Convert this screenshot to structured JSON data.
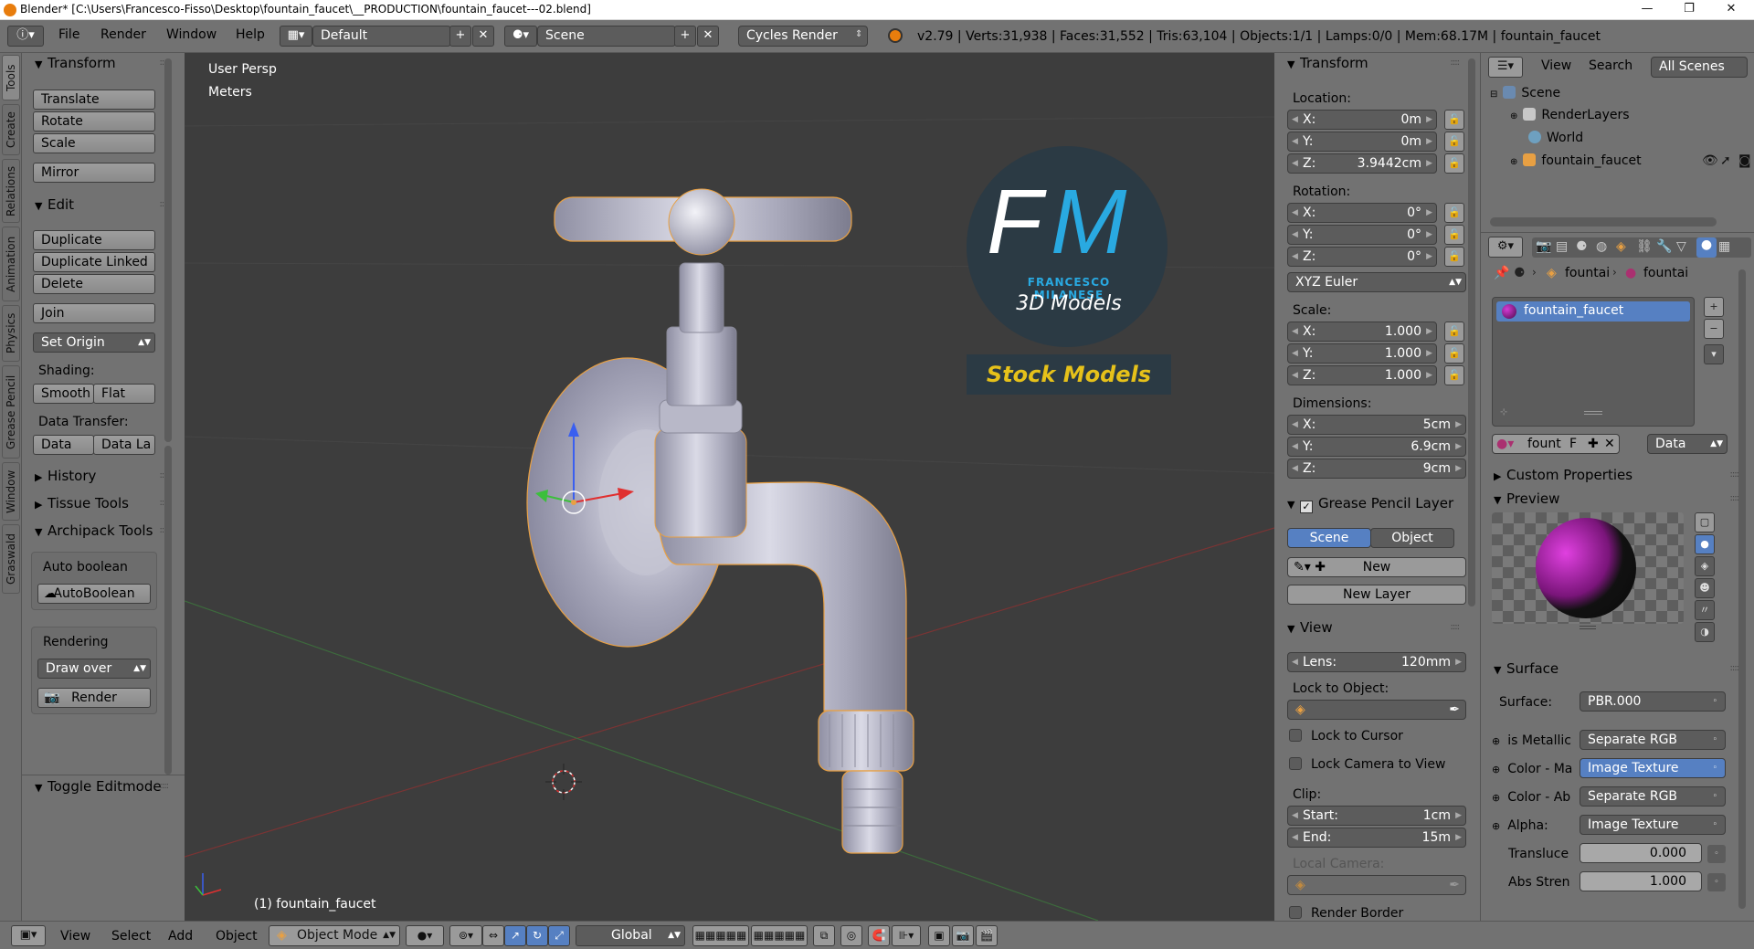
{
  "titlebar": {
    "title": "Blender* [C:\\Users\\Francesco-Fisso\\Desktop\\fountain_faucet\\__PRODUCTION\\fountain_faucet---02.blend]",
    "minimize": "—",
    "maximize": "❐",
    "close": "✕"
  },
  "infobar": {
    "menus": [
      "File",
      "Render",
      "Window",
      "Help"
    ],
    "layout": "Default",
    "scene": "Scene",
    "engine": "Cycles Render",
    "stats": "v2.79 | Verts:31,938 | Faces:31,552 | Tris:63,104 | Objects:1/1 | Lamps:0/0 | Mem:68.17M | fountain_faucet"
  },
  "lefttabs": [
    "Tools",
    "Create",
    "Relations",
    "Animation",
    "Physics",
    "Grease Pencil",
    "Window",
    "Graswald"
  ],
  "toolshelf": {
    "transform_header": "Transform",
    "translate": "Translate",
    "rotate": "Rotate",
    "scale": "Scale",
    "mirror": "Mirror",
    "edit_header": "Edit",
    "duplicate": "Duplicate",
    "duplicate_linked": "Duplicate Linked",
    "delete": "Delete",
    "join": "Join",
    "set_origin": "Set Origin",
    "shading_label": "Shading:",
    "smooth": "Smooth",
    "flat": "Flat",
    "data_transfer_label": "Data Transfer:",
    "data": "Data",
    "data_la": "Data La",
    "history": "History",
    "tissue_tools": "Tissue Tools",
    "archipack": "Archipack Tools",
    "auto_boolean_label": "Auto boolean",
    "autoboolean_btn": "AutoBoolean",
    "rendering_label": "Rendering",
    "draw_over": "Draw over",
    "render_btn": "Render",
    "toggle_editmode": "Toggle Editmode"
  },
  "viewport": {
    "view_name": "User Persp",
    "units": "Meters",
    "object_label": "(1) fountain_faucet",
    "logo_initials_f": "F",
    "logo_initials_m": "M",
    "logo_name": "FRANCESCO MILANESE",
    "logo_sub": "3D Models",
    "stock": "Stock Models"
  },
  "nprop": {
    "transform_header": "Transform",
    "location_label": "Location:",
    "loc_x": "0m",
    "loc_y": "0m",
    "loc_z": "3.9442cm",
    "rotation_label": "Rotation:",
    "rot_x": "0°",
    "rot_y": "0°",
    "rot_z": "0°",
    "rot_mode": "XYZ Euler",
    "scale_label": "Scale:",
    "scale_x": "1.000",
    "scale_y": "1.000",
    "scale_z": "1.000",
    "dimensions_label": "Dimensions:",
    "dim_x": "5cm",
    "dim_y": "6.9cm",
    "dim_z": "9cm",
    "x": "X:",
    "y": "Y:",
    "z": "Z:",
    "gp_header": "Grease Pencil Layer",
    "gp_scene": "Scene",
    "gp_object": "Object",
    "gp_new": "New",
    "gp_new_layer": "New Layer",
    "view_header": "View",
    "lens_label": "Lens:",
    "lens": "120mm",
    "lock_object_label": "Lock to Object:",
    "lock_cursor": "Lock to Cursor",
    "lock_camera": "Lock Camera to View",
    "clip_label": "Clip:",
    "clip_start_label": "Start:",
    "clip_start": "1cm",
    "clip_end_label": "End:",
    "clip_end": "15m",
    "local_camera_label": "Local Camera:",
    "render_border": "Render Border"
  },
  "outliner": {
    "view": "View",
    "search": "Search",
    "all_scenes": "All Scenes",
    "items": [
      "Scene",
      "RenderLayers",
      "World",
      "fountain_faucet"
    ]
  },
  "properties": {
    "crumb1": "fountai",
    "crumb2": "fountai",
    "material_slot": "fountain_faucet",
    "mat_name": "fount",
    "mat_f": "F",
    "data_select": "Data",
    "custom_props": "Custom Properties",
    "preview": "Preview",
    "surface_header": "Surface",
    "surface_label": "Surface:",
    "surface_value": "PBR.000",
    "rows": [
      {
        "label": "is Metallic",
        "value": "Separate RGB"
      },
      {
        "label": "Color - Ma",
        "value": "Image Texture"
      },
      {
        "label": "Color - Ab",
        "value": "Separate RGB"
      },
      {
        "label": "Alpha:",
        "value": "Image Texture"
      }
    ],
    "translucence_label": "Transluce",
    "translucence_value": "0.000",
    "abs_label": "Abs Stren",
    "abs_value": "1.000"
  },
  "bottombar": {
    "view": "View",
    "select": "Select",
    "add": "Add",
    "object": "Object",
    "mode": "Object Mode",
    "orientation": "Global"
  },
  "colors": {
    "accent_blue": "#5680c2",
    "panel_grey": "#727272",
    "viewport_bg": "#3d3d3d",
    "logo_cyan": "#29a9e1",
    "stock_yellow": "#e6c11a"
  }
}
